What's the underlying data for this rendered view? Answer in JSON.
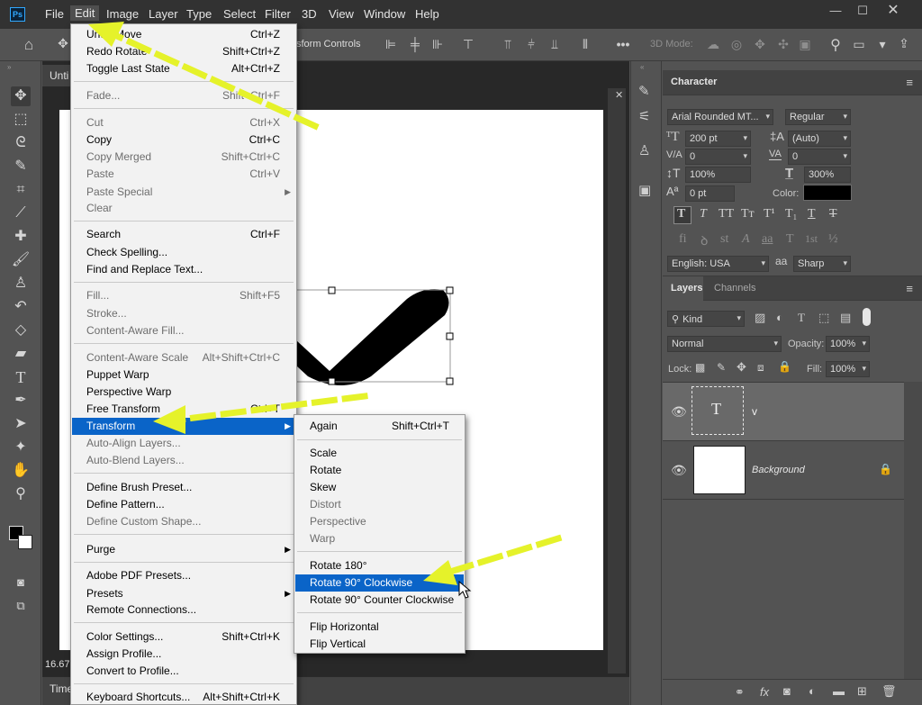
{
  "menubar": {
    "logo": "Ps",
    "items": [
      "File",
      "Edit",
      "Image",
      "Layer",
      "Type",
      "Select",
      "Filter",
      "3D",
      "View",
      "Window",
      "Help"
    ]
  },
  "optbar": {
    "transform_controls": "sform Controls",
    "mode_3d": "3D Mode:"
  },
  "document": {
    "tab": "Unti",
    "zoom": "16.67",
    "timeline": "Time"
  },
  "character": {
    "tab": "Character",
    "font_family": "Arial Rounded MT...",
    "font_style": "Regular",
    "font_size": "200 pt",
    "leading": "(Auto)",
    "kerning": "0",
    "tracking": "0",
    "vscale": "100%",
    "hscale": "300%",
    "baseline": "0 pt",
    "color_label": "Color:",
    "language": "English: USA",
    "antialias": "Sharp",
    "type_buttons": [
      "T",
      "T",
      "TT",
      "Tт",
      "T¹",
      "T₁",
      "T",
      "T"
    ],
    "ot_buttons": [
      "fi",
      "ꝺ",
      "st",
      "A",
      "aa",
      "T",
      "1st",
      "½"
    ]
  },
  "layers": {
    "tabs": [
      "Layers",
      "Channels"
    ],
    "filter_kind": "Kind",
    "blend_mode": "Normal",
    "opacity_label": "Opacity:",
    "opacity": "100%",
    "lock_label": "Lock:",
    "fill_label": "Fill:",
    "fill": "100%",
    "items": [
      {
        "name": "v",
        "thumb": "T"
      },
      {
        "name": "Background"
      }
    ]
  },
  "edit_menu": [
    {
      "label": "Undo Move",
      "shortcut": "Ctrl+Z"
    },
    {
      "label": "Redo Rotate",
      "shortcut": "Shift+Ctrl+Z"
    },
    {
      "label": "Toggle Last State",
      "shortcut": "Alt+Ctrl+Z"
    },
    {
      "label": "Fade...",
      "shortcut": "Shift+Ctrl+F",
      "disabled": true
    },
    {
      "label": "Cut",
      "shortcut": "Ctrl+X",
      "disabled": true
    },
    {
      "label": "Copy",
      "shortcut": "Ctrl+C"
    },
    {
      "label": "Copy Merged",
      "shortcut": "Shift+Ctrl+C",
      "disabled": true
    },
    {
      "label": "Paste",
      "shortcut": "Ctrl+V",
      "disabled": true
    },
    {
      "label": "Paste Special",
      "shortcut": "",
      "disabled": true,
      "submenu": true
    },
    {
      "label": "Clear",
      "shortcut": "",
      "disabled": true
    },
    {
      "label": "Search",
      "shortcut": "Ctrl+F"
    },
    {
      "label": "Check Spelling...",
      "shortcut": ""
    },
    {
      "label": "Find and Replace Text...",
      "shortcut": ""
    },
    {
      "label": "Fill...",
      "shortcut": "Shift+F5",
      "disabled": true
    },
    {
      "label": "Stroke...",
      "shortcut": "",
      "disabled": true
    },
    {
      "label": "Content-Aware Fill...",
      "shortcut": "",
      "disabled": true
    },
    {
      "label": "Content-Aware Scale",
      "shortcut": "Alt+Shift+Ctrl+C",
      "disabled": true
    },
    {
      "label": "Puppet Warp",
      "shortcut": ""
    },
    {
      "label": "Perspective Warp",
      "shortcut": ""
    },
    {
      "label": "Free Transform",
      "shortcut": "Ctrl+T"
    },
    {
      "label": "Transform",
      "shortcut": "",
      "submenu": true,
      "highlighted": true
    },
    {
      "label": "Auto-Align Layers...",
      "shortcut": "",
      "disabled": true
    },
    {
      "label": "Auto-Blend Layers...",
      "shortcut": "",
      "disabled": true
    },
    {
      "label": "Define Brush Preset...",
      "shortcut": ""
    },
    {
      "label": "Define Pattern...",
      "shortcut": ""
    },
    {
      "label": "Define Custom Shape...",
      "shortcut": "",
      "disabled": true
    },
    {
      "label": "Purge",
      "shortcut": "",
      "submenu": true
    },
    {
      "label": "Adobe PDF Presets...",
      "shortcut": ""
    },
    {
      "label": "Presets",
      "shortcut": "",
      "submenu": true
    },
    {
      "label": "Remote Connections...",
      "shortcut": ""
    },
    {
      "label": "Color Settings...",
      "shortcut": "Shift+Ctrl+K"
    },
    {
      "label": "Assign Profile...",
      "shortcut": ""
    },
    {
      "label": "Convert to Profile...",
      "shortcut": ""
    },
    {
      "label": "Keyboard Shortcuts...",
      "shortcut": "Alt+Shift+Ctrl+K"
    }
  ],
  "transform_menu": [
    {
      "label": "Again",
      "shortcut": "Shift+Ctrl+T"
    },
    {
      "label": "Scale",
      "shortcut": ""
    },
    {
      "label": "Rotate",
      "shortcut": ""
    },
    {
      "label": "Skew",
      "shortcut": ""
    },
    {
      "label": "Distort",
      "shortcut": "",
      "disabled": true
    },
    {
      "label": "Perspective",
      "shortcut": "",
      "disabled": true
    },
    {
      "label": "Warp",
      "shortcut": "",
      "disabled": true
    },
    {
      "label": "Rotate 180°",
      "shortcut": ""
    },
    {
      "label": "Rotate 90° Clockwise",
      "shortcut": "",
      "highlighted": true
    },
    {
      "label": "Rotate 90° Counter Clockwise",
      "shortcut": ""
    },
    {
      "label": "Flip Horizontal",
      "shortcut": ""
    },
    {
      "label": "Flip Vertical",
      "shortcut": ""
    }
  ],
  "colors": {
    "highlight": "#0a64c8",
    "arrow": "#e5f22a",
    "ps_blue": "#31a8ff"
  }
}
